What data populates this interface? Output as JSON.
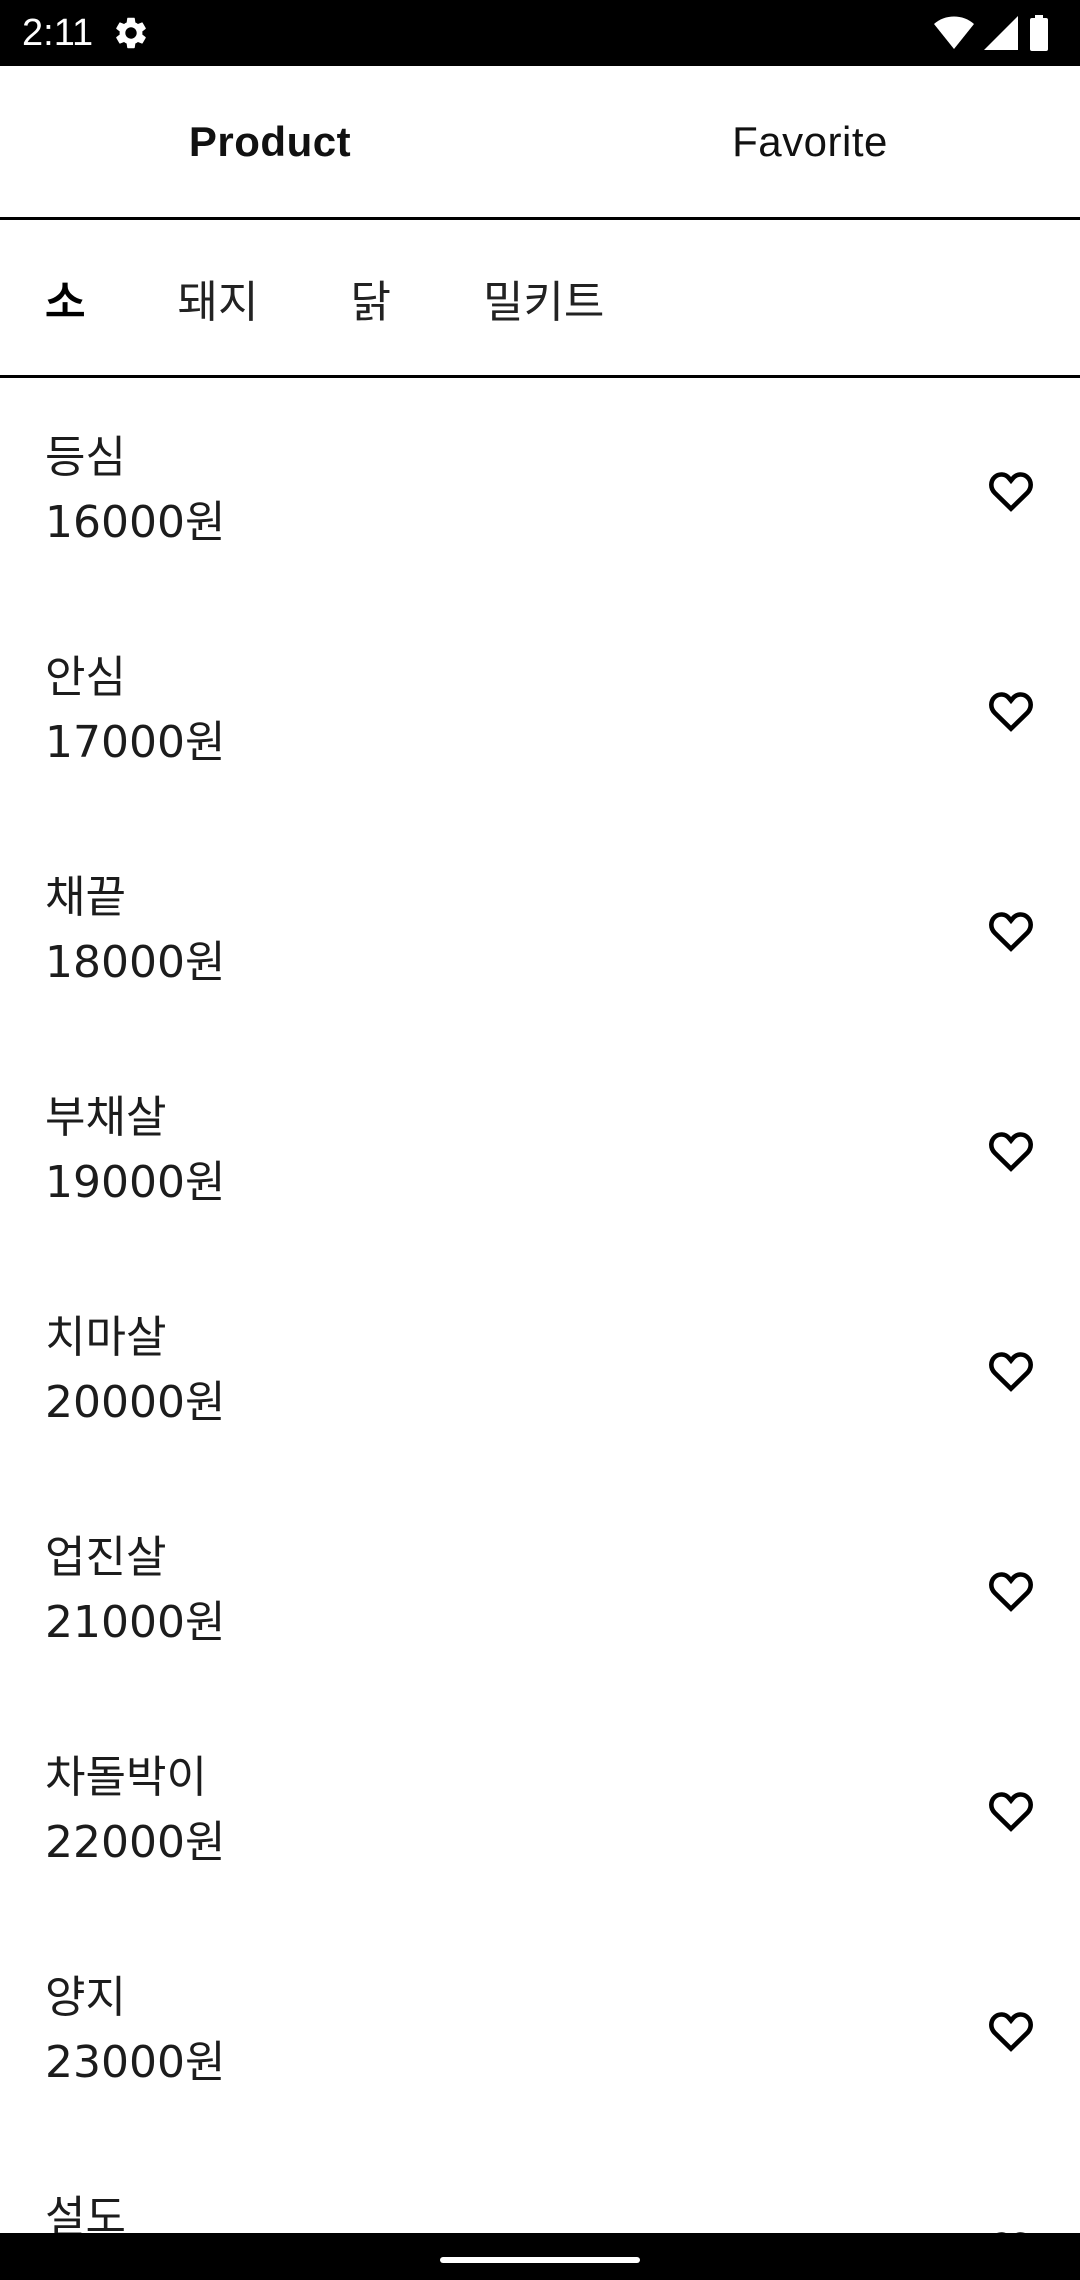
{
  "status_bar": {
    "time": "2:11",
    "icons": [
      "gear-icon",
      "wifi-icon",
      "signal-icon",
      "battery-icon"
    ]
  },
  "tabs": [
    {
      "label": "Product",
      "active": true
    },
    {
      "label": "Favorite",
      "active": false
    }
  ],
  "categories": [
    {
      "label": "소",
      "active": true
    },
    {
      "label": "돼지",
      "active": false
    },
    {
      "label": "닭",
      "active": false
    },
    {
      "label": "밀키트",
      "active": false
    }
  ],
  "products": [
    {
      "name": "등심",
      "price": "16000원"
    },
    {
      "name": "안심",
      "price": "17000원"
    },
    {
      "name": "채끝",
      "price": "18000원"
    },
    {
      "name": "부채살",
      "price": "19000원"
    },
    {
      "name": "치마살",
      "price": "20000원"
    },
    {
      "name": "업진살",
      "price": "21000원"
    },
    {
      "name": "차돌박이",
      "price": "22000원"
    },
    {
      "name": "양지",
      "price": "23000원"
    },
    {
      "name": "설도",
      "price": ""
    }
  ],
  "colors": {
    "status_bar_bg": "#000000",
    "text": "#1c1c1c",
    "divider": "#000000"
  }
}
